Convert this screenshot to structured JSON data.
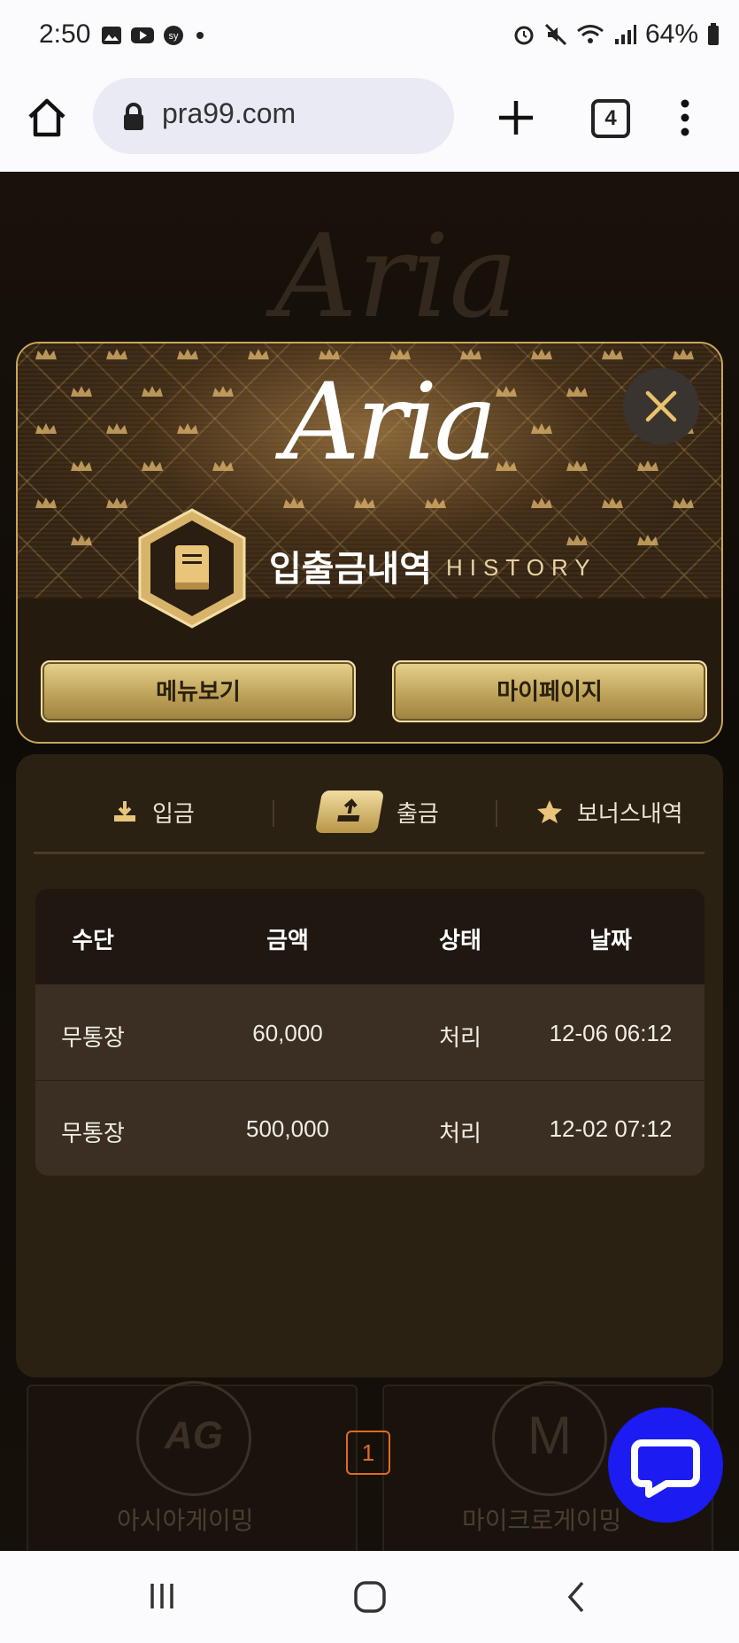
{
  "status_bar": {
    "time": "2:50",
    "battery": "64%"
  },
  "browser": {
    "url": "pra99.com",
    "tab_count": "4"
  },
  "background": {
    "logo": "Aria",
    "cards": [
      "아시아게이밍",
      "마이크로게이밍"
    ],
    "card_logos": [
      "AG",
      "M"
    ]
  },
  "header": {
    "logo": "Aria",
    "title": "입출금내역",
    "subtitle": "HISTORY",
    "menu_button": "메뉴보기",
    "mypage_button": "마이페이지"
  },
  "tabs": [
    {
      "label": "입금",
      "icon": "download-icon",
      "active": false
    },
    {
      "label": "출금",
      "icon": "upload-icon",
      "active": true
    },
    {
      "label": "보너스내역",
      "icon": "star-icon",
      "active": false
    }
  ],
  "table": {
    "columns": [
      "수단",
      "금액",
      "상태",
      "날짜"
    ],
    "rows": [
      {
        "method": "무통장",
        "amount": "60,000",
        "status": "처리",
        "date": "12-06 06:12"
      },
      {
        "method": "무통장",
        "amount": "500,000",
        "status": "처리",
        "date": "12-02 07:12"
      }
    ]
  },
  "pagination": {
    "current": "1"
  },
  "colors": {
    "gold": "#c9a758",
    "panel": "#2a2113",
    "page_active": "#e06b20",
    "chat": "#1b1bf2"
  }
}
